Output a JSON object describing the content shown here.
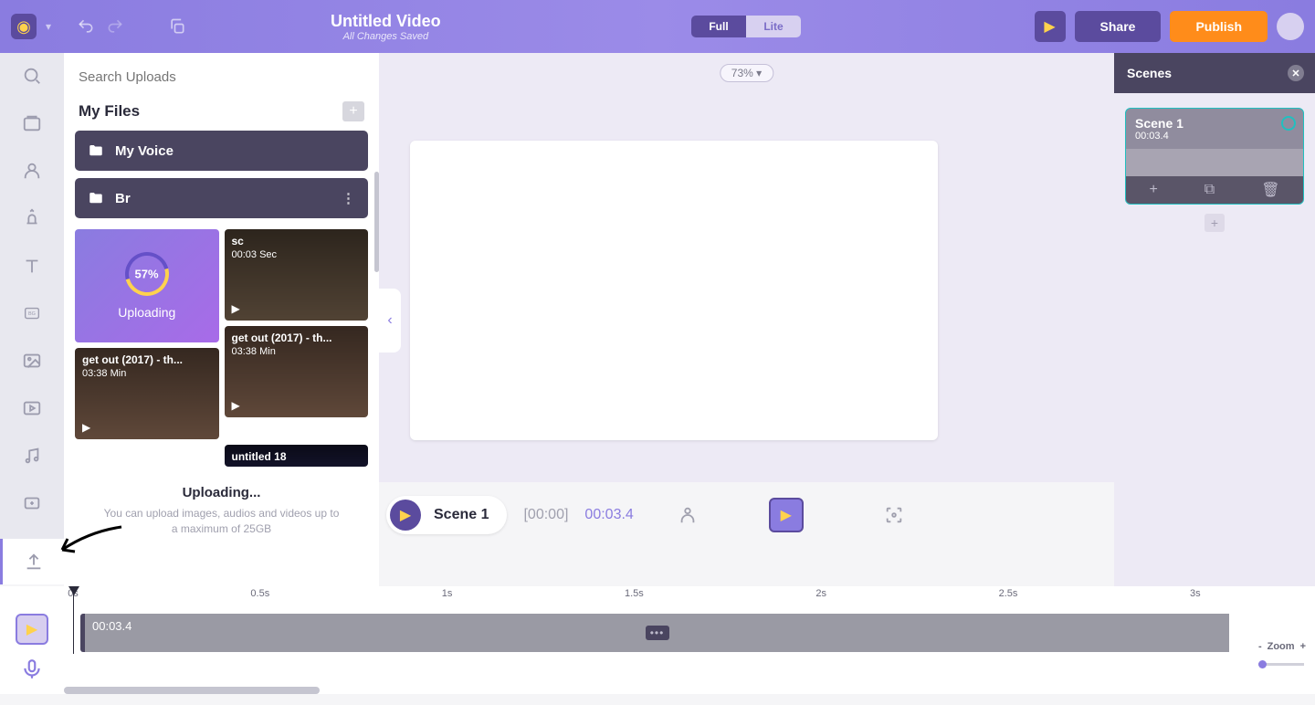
{
  "header": {
    "title": "Untitled Video",
    "subtitle": "All Changes Saved",
    "mode_full": "Full",
    "mode_lite": "Lite",
    "share": "Share",
    "publish": "Publish"
  },
  "uploads": {
    "search_placeholder": "Search Uploads",
    "section_title": "My Files",
    "folders": [
      {
        "name": "My Voice"
      },
      {
        "name": "Br"
      }
    ],
    "tiles": {
      "uploading_percent": "57%",
      "uploading_label": "Uploading",
      "sc": {
        "title": "sc",
        "dur": "00:03 Sec"
      },
      "gt1": {
        "title": "get out (2017) - th...",
        "dur": "03:38 Min"
      },
      "gt2": {
        "title": "get out (2017) - th...",
        "dur": "03:38 Min"
      },
      "u18": {
        "title": "untitled 18"
      }
    },
    "uploading_status": "Uploading...",
    "hint": "You can upload images, audios and videos up to a maximum of 25GB"
  },
  "canvas": {
    "zoom": "73%"
  },
  "scenes": {
    "title": "Scenes",
    "scene1_name": "Scene 1",
    "scene1_time": "00:03.4"
  },
  "playbar": {
    "scene": "Scene 1",
    "t0": "[00:00]",
    "t1": "00:03.4"
  },
  "timeline": {
    "marks": [
      "0s",
      "0.5s",
      "1s",
      "1.5s",
      "2s",
      "2.5s",
      "3s"
    ],
    "clip_time": "00:03.4",
    "zoom_label": "Zoom",
    "zoom_minus": "-",
    "zoom_plus": "+"
  }
}
